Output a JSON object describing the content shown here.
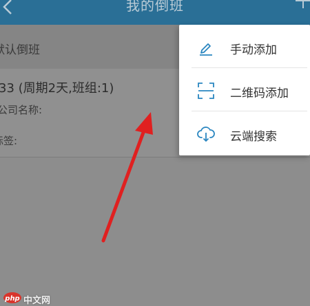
{
  "header": {
    "title": "我的倒班",
    "back_icon": "chevron-left-icon",
    "add_icon": "plus-icon"
  },
  "section": {
    "title": "默认倒班"
  },
  "card": {
    "name": "33 (周期2天,班组:1)",
    "company": "公司名称:",
    "tags": "标签:"
  },
  "menu": {
    "items": [
      {
        "label": "手动添加",
        "icon": "pencil-icon"
      },
      {
        "label": "二维码添加",
        "icon": "qr-scan-icon"
      },
      {
        "label": "云端搜索",
        "icon": "cloud-download-icon"
      }
    ]
  },
  "colors": {
    "header_bg": "#2a6f96",
    "menu_icon": "#2a86c0",
    "annotation_arrow": "#e02020"
  },
  "watermark": {
    "logo": "php",
    "text": "中文网"
  }
}
